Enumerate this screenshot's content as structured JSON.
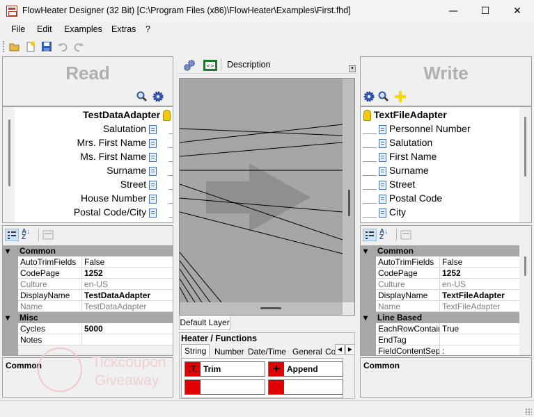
{
  "window": {
    "title": "FlowHeater Designer (32 Bit) [C:\\Program Files (x86)\\FlowHeater\\Examples\\First.fhd]",
    "minimize": "—",
    "maximize": "☐",
    "close": "✕"
  },
  "menu": [
    "File",
    "Edit",
    "Examples",
    "Extras",
    "?"
  ],
  "read": {
    "title": "Read",
    "adapter": "TestDataAdapter",
    "fields": [
      "Salutation",
      "Mrs. First Name",
      "Ms. First Name",
      "Surname",
      "Street",
      "House Number",
      "Postal Code/City"
    ],
    "props": {
      "common_label": "Common",
      "rows": [
        {
          "name": "AutoTrimFields",
          "value": "False"
        },
        {
          "name": "CodePage",
          "value": "1252"
        },
        {
          "name": "Culture",
          "value": "en-US"
        },
        {
          "name": "DisplayName",
          "value": "TestDataAdapter"
        },
        {
          "name": "Name",
          "value": "TestDataAdapter"
        }
      ],
      "misc_label": "Misc",
      "misc_rows": [
        {
          "name": "Cycles",
          "value": "5000"
        },
        {
          "name": "Notes",
          "value": ""
        }
      ]
    },
    "desc_title": "Common"
  },
  "middle": {
    "description_label": "Description",
    "layer_tab": "Default Layer",
    "heater_title": "Heater / Functions",
    "tabs": [
      "String",
      "Number",
      "Date/Time",
      "General",
      "Co"
    ],
    "functions": [
      "Trim",
      "Append"
    ]
  },
  "write": {
    "title": "Write",
    "adapter": "TextFileAdapter",
    "fields": [
      "Personnel Number",
      "Salutation",
      "First Name",
      "Surname",
      "Street",
      "Postal Code",
      "City"
    ],
    "props": {
      "common_label": "Common",
      "rows": [
        {
          "name": "AutoTrimFields",
          "value": "False"
        },
        {
          "name": "CodePage",
          "value": "1252"
        },
        {
          "name": "Culture",
          "value": "en-US"
        },
        {
          "name": "DisplayName",
          "value": "TextFileAdapter"
        },
        {
          "name": "Name",
          "value": "TextFileAdapter"
        }
      ],
      "line_label": "Line Based",
      "line_rows": [
        {
          "name": "EachRowContains",
          "value": "True"
        },
        {
          "name": "EndTag",
          "value": ""
        },
        {
          "name": "FieldContentSepar",
          "value": ":"
        }
      ]
    },
    "desc_title": "Common"
  },
  "watermark": {
    "line1": "Tickcoupon",
    "line2": "Giveaway"
  },
  "colors": {
    "function_icon": "#e00000",
    "category_bg": "#a8a8a8",
    "canvas_bg": "#a6a6a6"
  }
}
